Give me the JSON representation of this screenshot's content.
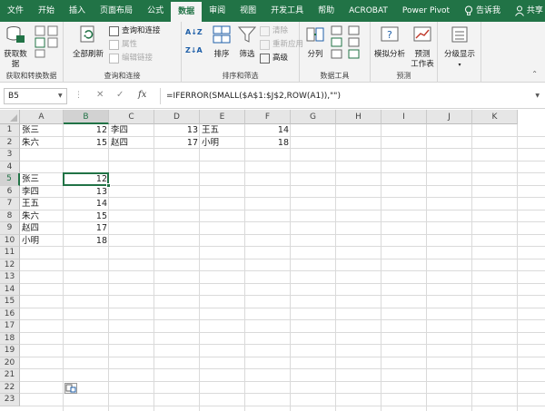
{
  "tabs": [
    {
      "label": "文件",
      "active": false
    },
    {
      "label": "开始",
      "active": false
    },
    {
      "label": "插入",
      "active": false
    },
    {
      "label": "页面布局",
      "active": false
    },
    {
      "label": "公式",
      "active": false
    },
    {
      "label": "数据",
      "active": true
    },
    {
      "label": "审阅",
      "active": false
    },
    {
      "label": "视图",
      "active": false
    },
    {
      "label": "开发工具",
      "active": false
    },
    {
      "label": "帮助",
      "active": false
    },
    {
      "label": "ACROBAT",
      "active": false
    },
    {
      "label": "Power Pivot",
      "active": false
    }
  ],
  "tell_me": "告诉我",
  "share": "共享",
  "ribbon": {
    "get_data": {
      "line1": "获取数",
      "line2": "据"
    },
    "get_transform_label": "获取和转换数据",
    "refresh_all": "全部刷新",
    "queries_connections": "查询和连接",
    "properties": "属性",
    "edit_links": "编辑链接",
    "queries_group_label": "查询和连接",
    "sort_az": "A↓Z",
    "sort_za": "Z↓A",
    "sort": "排序",
    "filter": "筛选",
    "clear": "清除",
    "reapply": "重新应用",
    "advanced": "高级",
    "sort_filter_label": "排序和筛选",
    "text_to_columns": "分列",
    "data_tools_label": "数据工具",
    "what_if": "模拟分析",
    "forecast_sheet": {
      "line1": "预测",
      "line2": "工作表"
    },
    "forecast_label": "预测",
    "outline": "分级显示"
  },
  "formula_bar": {
    "name_box": "B5",
    "cancel": "✕",
    "enter": "✓",
    "fx": "fx",
    "formula": "=IFERROR(SMALL($A$1:$J$2,ROW(A1)),\"\")"
  },
  "columns": [
    "A",
    "B",
    "C",
    "D",
    "E",
    "F",
    "G",
    "H",
    "I",
    "J",
    "K"
  ],
  "rows": [
    "1",
    "2",
    "3",
    "4",
    "5",
    "6",
    "7",
    "8",
    "9",
    "10",
    "11",
    "12",
    "13",
    "14",
    "15",
    "16",
    "17",
    "18",
    "19",
    "20",
    "21",
    "22",
    "23"
  ],
  "cells": {
    "A1": "张三",
    "B1": "12",
    "C1": "李四",
    "D1": "13",
    "E1": "王五",
    "F1": "14",
    "A2": "朱六",
    "B2": "15",
    "C2": "赵四",
    "D2": "17",
    "E2": "小明",
    "F2": "18",
    "A5": "张三",
    "B5": "12",
    "A6": "李四",
    "B6": "13",
    "A7": "王五",
    "B7": "14",
    "A8": "朱六",
    "B8": "15",
    "A9": "赵四",
    "B9": "17",
    "A10": "小明",
    "B10": "18"
  },
  "selected_cell": "B5",
  "colors": {
    "excel_green": "#217346",
    "ribbon_bg": "#f3f3f3"
  }
}
